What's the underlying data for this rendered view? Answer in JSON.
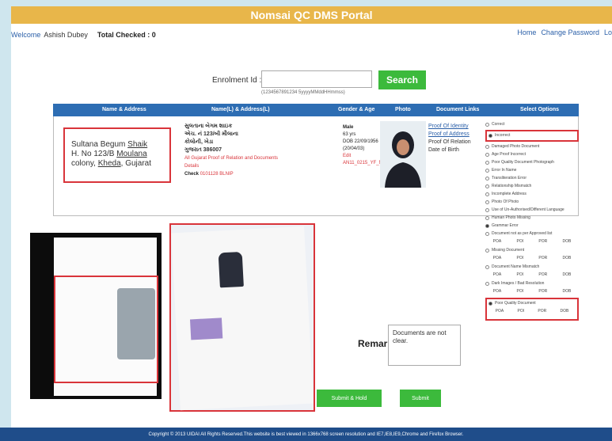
{
  "header": {
    "title": "Nomsai QC DMS Portal"
  },
  "userbar": {
    "welcome_label": "Welcome",
    "user_name": "Ashish Dubey",
    "total_checked": "Total Checked : 0",
    "links": [
      "Home",
      "Change Password",
      "Lo"
    ]
  },
  "search": {
    "enrolment_label": "Enrolment Id :",
    "enrolment_value": "",
    "hint": "(1234567891234 5yyyyMMddHHmmss)",
    "button_label": "Search"
  },
  "table": {
    "headers": [
      "Name & Address",
      "Name(L) & Address(L)",
      "Gender & Age",
      "Photo",
      "Document Links",
      "Select Options"
    ],
    "name_address": {
      "line1_a": "Sultana Begum ",
      "line1_b": "Shaik",
      "line2_a": "H. No 123/B ",
      "line2_b": "Moulana",
      "line3_a": "colony, ",
      "line3_b": "Kheda",
      "line3_c": ", Gujarat"
    },
    "local_address": {
      "l1": "સુલતાના બેગમ શાઇક",
      "l2": "એચ. નં 123/બી મૌલાના",
      "l3": "કોલોની, ખેડા",
      "l4": "ગુજરાત 386007",
      "red": "All Gujarat Proof of Relation and Documents",
      "red2": "Details",
      "check_label": "Check",
      "check_value": "0101128 BLNIP"
    },
    "gender_age": {
      "gender": "Male",
      "age": "63 yrs",
      "dob": "DOB 22/09/1956",
      "date2": "(20/04/03)",
      "red1": "Edit",
      "red2": "AN11_0215_YF_NK1057"
    },
    "doc_links": {
      "poi": "Proof Of Identity",
      "poa": "Proof of Address",
      "por": "Proof Of Relation",
      "dob": "Date of Birth"
    }
  },
  "options": {
    "items": [
      {
        "label": "Correct",
        "selected": false
      },
      {
        "label": "Incorrect",
        "selected": true,
        "highlight": true
      },
      {
        "label": "Damaged Photo Document",
        "selected": false
      },
      {
        "label": "Age Proof Incorrect",
        "selected": false
      },
      {
        "label": "Poor Quality Document Photograph",
        "selected": false
      },
      {
        "label": "Error In Name",
        "selected": false
      },
      {
        "label": "Transliteration Error",
        "selected": false
      },
      {
        "label": "Relationship Mismatch",
        "selected": false
      },
      {
        "label": "Incomplete Address",
        "selected": false
      },
      {
        "label": "Photo Of Photo",
        "selected": false
      },
      {
        "label": "Use of Un-Authorised/Different Language",
        "selected": false
      },
      {
        "label": "Human Photo Missing",
        "selected": false
      },
      {
        "label": "Grammar Error",
        "selected": true
      },
      {
        "label": "Document not as per Approved list",
        "selected": false
      }
    ],
    "sub_options": [
      "POA",
      "POI",
      "POR",
      "DOB"
    ],
    "group2": "Missing Document",
    "group3": "Document Name Mismatch",
    "group4": "Dark Images / Bad Resolution",
    "highlight_item": "Poor Quality Document",
    "highlight_subs": [
      "POA",
      "POI",
      "POR",
      "DOB"
    ]
  },
  "remark": {
    "label": "Remark:",
    "text": "Documents are not clear."
  },
  "buttons": {
    "submit_hold": "Submit & Hold",
    "submit": "Submit"
  },
  "footer": {
    "text": "Copyright © 2013 UIDAI All Rights Reserved.This website is best viewed in 1366x768 screen resolution and IE7,IE8,IE9,Chrome and Firefox Browser."
  }
}
